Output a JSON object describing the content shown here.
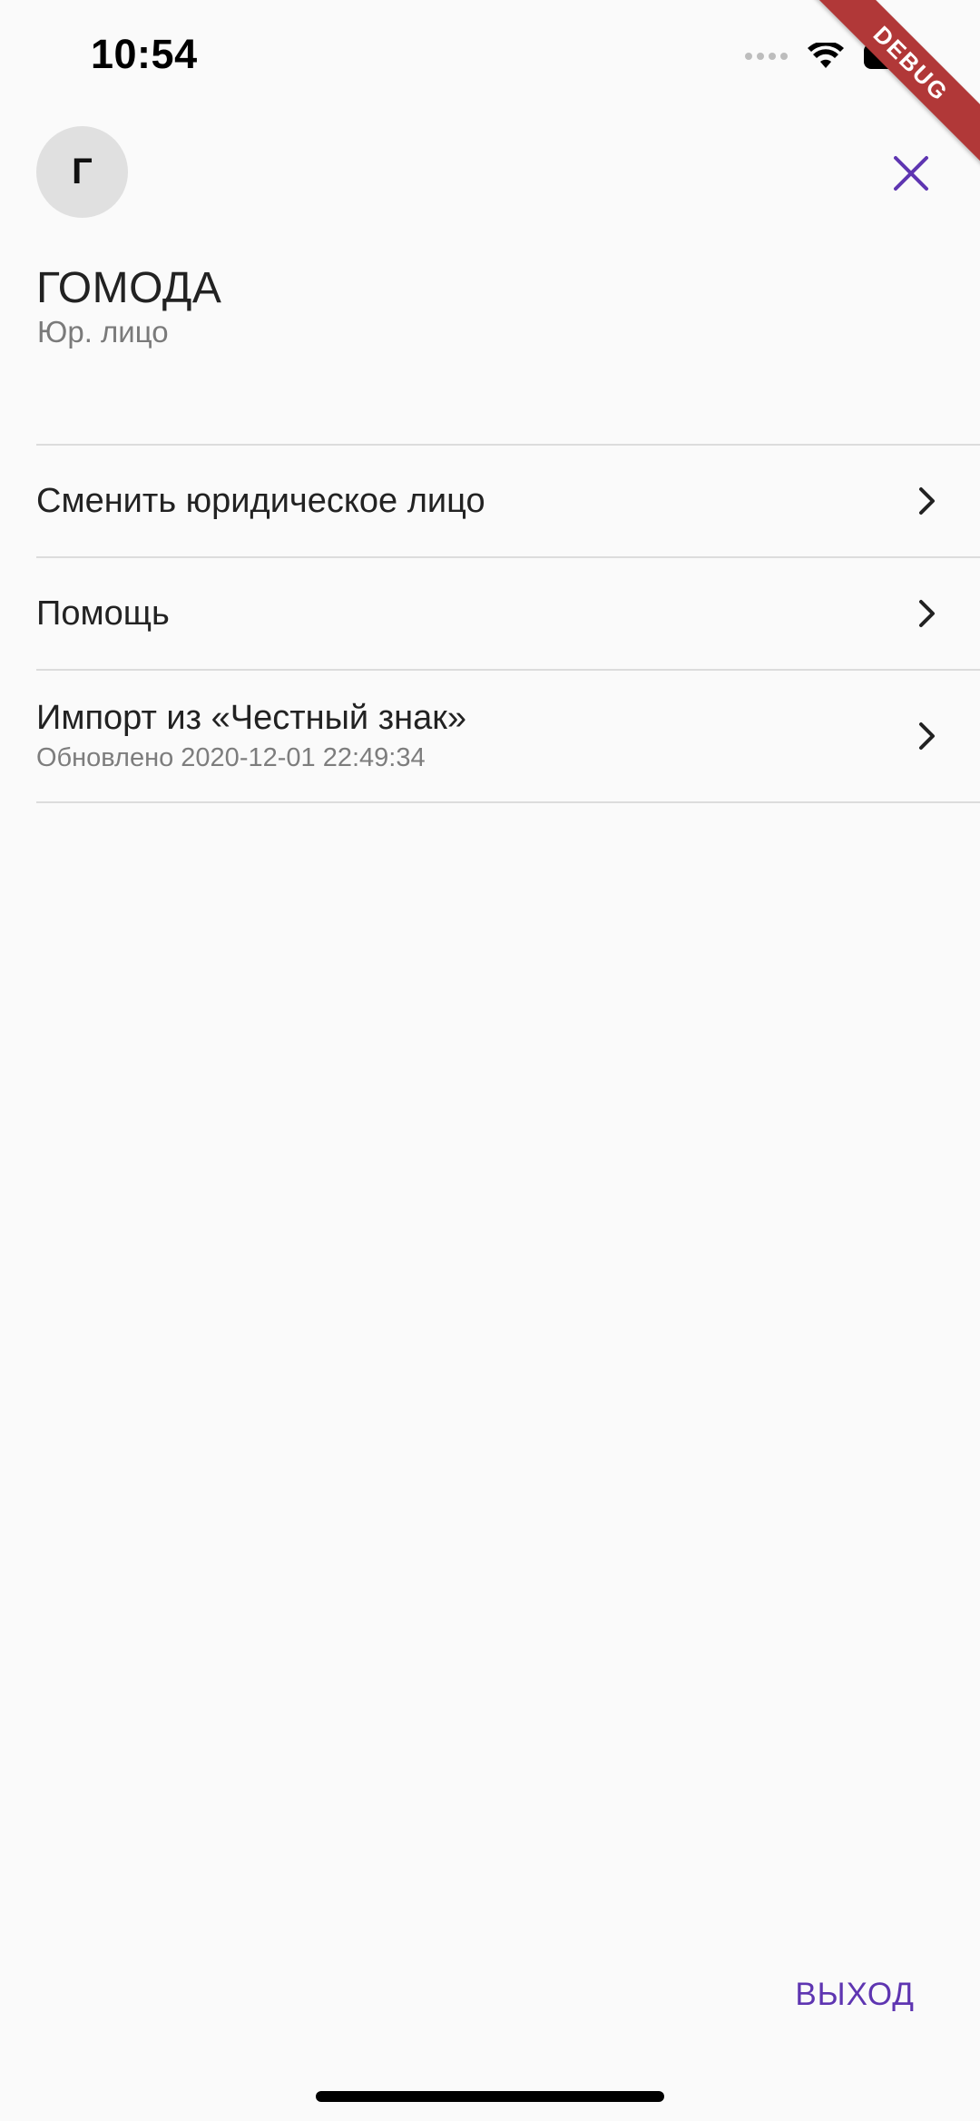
{
  "status_bar": {
    "time": "10:54"
  },
  "debug_banner": {
    "label": "DEBUG",
    "color": "#b13838"
  },
  "header": {
    "avatar_initial": "Г",
    "org_name": "ГОМОДА",
    "org_type": "Юр. лицо",
    "close_icon": "close-icon",
    "accent_color": "#5e35b1"
  },
  "menu": {
    "items": [
      {
        "title": "Сменить юридическое лицо",
        "icon": "chevron-right-icon"
      },
      {
        "title": "Помощь",
        "icon": "chevron-right-icon"
      },
      {
        "title": "Импорт из «Честный знак»",
        "subtitle": "Обновлено 2020-12-01 22:49:34",
        "icon": "chevron-right-icon"
      }
    ]
  },
  "footer": {
    "logout_label": "ВЫХОД"
  }
}
